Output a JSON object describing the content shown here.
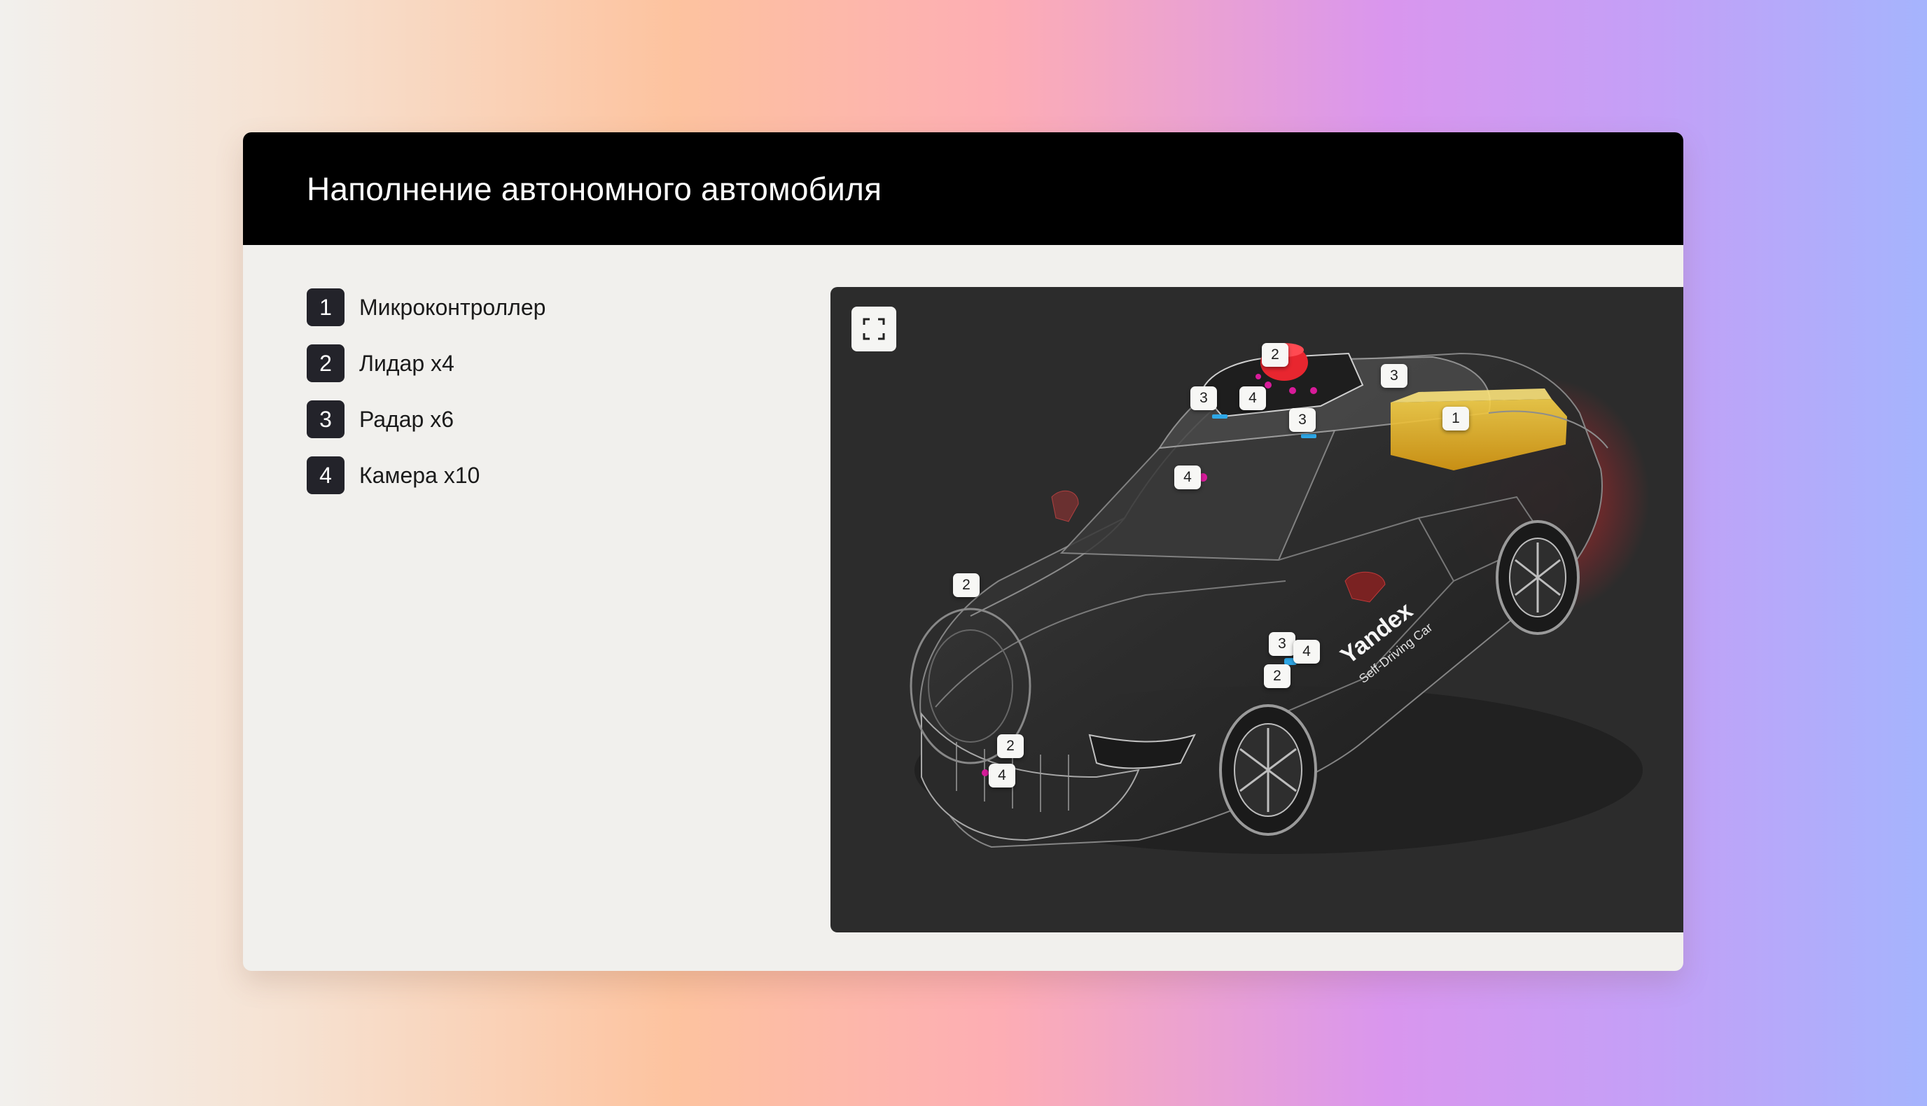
{
  "header": {
    "title": "Наполнение автономного автомобиля"
  },
  "legend": [
    {
      "number": "1",
      "label": "Микроконтроллер"
    },
    {
      "number": "2",
      "label": "Лидар x4"
    },
    {
      "number": "3",
      "label": "Радар x6"
    },
    {
      "number": "4",
      "label": "Камера x10"
    }
  ],
  "viewer": {
    "fullscreen_icon": "expand-icon",
    "car_brand_text": "Yandex",
    "car_subtext": "Self-Driving Car",
    "markers": [
      "2",
      "3",
      "3",
      "4",
      "3",
      "1",
      "4",
      "2",
      "3",
      "4",
      "2",
      "2",
      "4"
    ]
  },
  "colors": {
    "background_gradient": [
      "#f2f0ed",
      "#fdc39f",
      "#fdadb4",
      "#d996ee",
      "#a5b4fd"
    ],
    "header_bg": "#000000",
    "card_bg": "#f1f0ed",
    "badge_bg": "#23232a",
    "viewer_bg": "#2c2c2c",
    "lidar_red": "#e8262f",
    "microcontroller_yellow": "#f5c518",
    "radar_blue": "#2fa8e8",
    "camera_magenta": "#d81b9a"
  }
}
